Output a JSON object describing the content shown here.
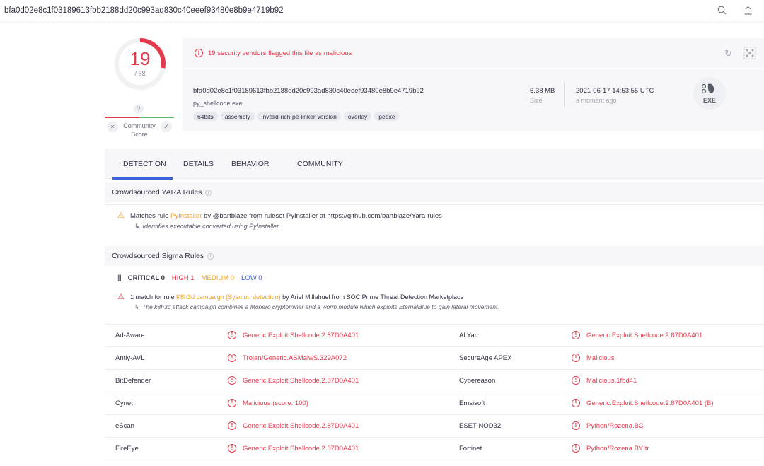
{
  "search": {
    "value": "bfa0d02e8c1f03189613fbb2188dd20c993ad830c40eeef93480e8b9e4719b92"
  },
  "score": {
    "positives": "19",
    "total": "/ 68",
    "color": "#e23b4d",
    "detected_ratio": 0.279,
    "community": {
      "question": "?",
      "label_line1": "Community",
      "label_line2": "Score",
      "down": "×",
      "up": "✓"
    }
  },
  "header": {
    "alert_text": "19 security vendors flagged this file as malicious",
    "hash": "bfa0d02e8c1f03189613fbb2188dd20c993ad830c40eeef93480e8b9e4719b92",
    "filename": "py_shellcode.exe",
    "tags": [
      "64bits",
      "assembly",
      "invalid-rich-pe-linker-version",
      "overlay",
      "peexe"
    ],
    "size_value": "6.38 MB",
    "size_label": "Size",
    "date_value": "2021-06-17 14:53:55 UTC",
    "date_label": "a moment ago",
    "file_type": "EXE"
  },
  "tabs": [
    "DETECTION",
    "DETAILS",
    "BEHAVIOR",
    "COMMUNITY"
  ],
  "yara": {
    "title": "Crowdsourced YARA Rules",
    "prefix": "Matches rule ",
    "rule": "PyInstaller",
    "suffix": " by @bartblaze from ruleset PyInstaller at https://github.com/bartblaze/Yara-rules",
    "description": "Identifies executable converted using PyInstaller."
  },
  "sigma": {
    "title": "Crowdsourced Sigma Rules",
    "critical": "CRITICAL 0",
    "high": "HIGH 1",
    "medium": "MEDIUM 0",
    "low": "LOW 0",
    "prefix": "1 match for rule ",
    "rule": "K8h3d campaign (Sysmon detection)",
    "suffix": " by Ariel Millahuel from SOC Prime Threat Detection Marketplace",
    "description": "The k8h3d attack campaign combines a Monero cryptominer and a worm module which exploits EternalBlue to gain lateral movement."
  },
  "detections": [
    {
      "left_vendor": "Ad-Aware",
      "left_result": "Generic.Exploit.Shellcode.2.87D0A401",
      "right_vendor": "ALYac",
      "right_result": "Generic.Exploit.Shellcode.2.87D0A401"
    },
    {
      "left_vendor": "Antiy-AVL",
      "left_result": "Trojan/Generic.ASMalwS.329A072",
      "right_vendor": "SecureAge APEX",
      "right_result": "Malicious"
    },
    {
      "left_vendor": "BitDefender",
      "left_result": "Generic.Exploit.Shellcode.2.87D0A401",
      "right_vendor": "Cybereason",
      "right_result": "Malicious.1fbd41"
    },
    {
      "left_vendor": "Cynet",
      "left_result": "Malicious (score: 100)",
      "right_vendor": "Emsisoft",
      "right_result": "Generic.Exploit.Shellcode.2.87D0A401 (B)"
    },
    {
      "left_vendor": "eScan",
      "left_result": "Generic.Exploit.Shellcode.2.87D0A401",
      "right_vendor": "ESET-NOD32",
      "right_result": "Python/Rozena.BC"
    },
    {
      "left_vendor": "FireEye",
      "left_result": "Generic.Exploit.Shellcode.2.87D0A401",
      "right_vendor": "Fortinet",
      "right_result": "Python/Rozena.BY!tr"
    }
  ],
  "colors": {
    "malicious": "#e23b4d",
    "accent": "#3b61e0",
    "highlight": "#f1a02b",
    "medium": "#f1a02b",
    "low": "#3b61e0",
    "critical": "#313244"
  },
  "icons": {
    "search": "search-icon",
    "upload": "upload-icon",
    "reload": "reload-icon",
    "graph": "graph-icon",
    "alert": "alert-circle-icon",
    "warning": "warning-icon",
    "info": "info-icon"
  }
}
